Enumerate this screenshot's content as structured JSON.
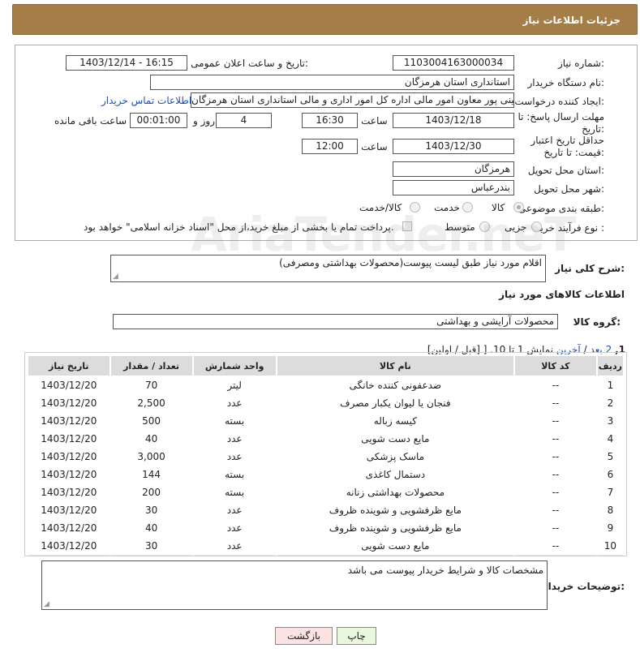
{
  "header": {
    "title": "جزئیات اطلاعات نیاز"
  },
  "form": {
    "need_number_label": "شماره نیاز:",
    "need_number": "1103004163000034",
    "announce_label": "تاریخ و ساعت اعلان عمومی:",
    "announce_value": "1403/12/14 - 16:15",
    "buyer_org_label": "نام دستگاه خریدار:",
    "buyer_org": "استانداری استان هرمزگان",
    "creator_label": "ایجاد کننده درخواست:",
    "creator": "علی معینی پور معاون امور مالی اداره کل امور اداری و مالی استانداری استان هرمزگان",
    "contact_link": "اطلاعات تماس خریدار",
    "deadline_label": "مهلت ارسال پاسخ: تا تاریخ:",
    "deadline_date": "1403/12/18",
    "time_label": "ساعت",
    "deadline_time": "16:30",
    "days": "4",
    "days_label": "روز و",
    "remaining_time": "00:01:00",
    "remaining_label": "ساعت باقی مانده",
    "validity_label": "حداقل تاریخ اعتبار قیمت: تا تاریخ:",
    "validity_date": "1403/12/30",
    "validity_time": "12:00",
    "province_label": "استان محل تحویل:",
    "province": "هرمزگان",
    "city_label": "شهر محل تحویل:",
    "city": "بندرعباس",
    "category_label": "طبقه بندی موضوعی:",
    "category_options": [
      "کالا",
      "خدمت",
      "کالا/خدمت"
    ],
    "process_label": "نوع فرآیند خرید :",
    "process_options": [
      "جزیی",
      "متوسط"
    ],
    "payment_note": "پرداخت تمام یا بخشی از مبلغ خرید،از محل \"اسناد خزانه اسلامی\" خواهد بود."
  },
  "summary": {
    "label": "شرح کلی نیاز:",
    "value": "اقلام  مورد نیاز طبق لیست پیوست(محصولات بهداشتی ومصرفی)"
  },
  "goods_section_title": "اطلاعات کالاهای مورد نیاز",
  "goods_group": {
    "label": "گروه کالا:",
    "value": "محصولات آرایشی و بهداشتی"
  },
  "pagination": {
    "prefix": "نمایش 1 تا 10. [",
    "last": "آخرین",
    "sep1": " / ",
    "next": "بعد",
    "page2": "2",
    "current": "1",
    "suffix": "[قبل / اولین]"
  },
  "table": {
    "headers": [
      "ردیف",
      "کد کالا",
      "نام کالا",
      "واحد شمارش",
      "تعداد / مقدار",
      "تاریخ نیاز"
    ],
    "rows": [
      [
        "1",
        "--",
        "ضدعفونی کننده خانگی",
        "لیتر",
        "70",
        "1403/12/20"
      ],
      [
        "2",
        "--",
        "فنجان یا لیوان یکبار مصرف",
        "عدد",
        "2,500",
        "1403/12/20"
      ],
      [
        "3",
        "--",
        "کیسه زباله",
        "بسته",
        "500",
        "1403/12/20"
      ],
      [
        "4",
        "--",
        "مایع دست شویی",
        "عدد",
        "40",
        "1403/12/20"
      ],
      [
        "5",
        "--",
        "ماسک پزشکی",
        "عدد",
        "3,000",
        "1403/12/20"
      ],
      [
        "6",
        "--",
        "دستمال کاغذی",
        "بسته",
        "144",
        "1403/12/20"
      ],
      [
        "7",
        "--",
        "محصولات بهداشتی زنانه",
        "بسته",
        "200",
        "1403/12/20"
      ],
      [
        "8",
        "--",
        "مایع ظرفشویی و شوینده ظروف",
        "عدد",
        "30",
        "1403/12/20"
      ],
      [
        "9",
        "--",
        "مایع ظرفشویی و شوینده ظروف",
        "عدد",
        "40",
        "1403/12/20"
      ],
      [
        "10",
        "--",
        "مایع دست شویی",
        "عدد",
        "30",
        "1403/12/20"
      ]
    ]
  },
  "buyer_notes": {
    "label": "توضیحات خریدار:",
    "value": "مشخصات کالا و شرایط خریدار پیوست می باشد"
  },
  "buttons": {
    "print": "چاپ",
    "back": "بازگشت"
  },
  "watermark": "AriaTender.neT",
  "colors": {
    "header_bg": "#a57d46",
    "link": "#1a4fb5",
    "print_btn": "#e9f7dc",
    "back_btn": "#fbe3e3"
  }
}
